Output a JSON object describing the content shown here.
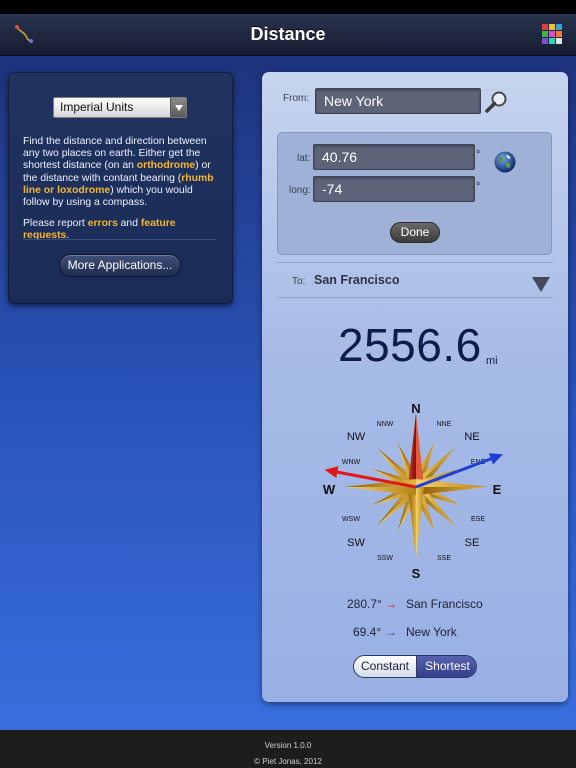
{
  "nav": {
    "title": "Distance",
    "left_icon": "route-icon",
    "right_icon": "color-grid-icon"
  },
  "left_panel": {
    "units_selected": "Imperial Units",
    "description": {
      "t1": "Find the distance and direction between any two places on earth. Either get the shortest distance (on an ",
      "hl1": "orthodrome",
      "t2": ") or the distance with contant bearing (",
      "hl2": "rhumb line or loxodrome",
      "t3": ") which you would follow by using a compass."
    },
    "report": {
      "t1": "Please report ",
      "hl1": "errors",
      "t2": " and ",
      "hl2": "feature requests",
      "t3": "."
    },
    "more_apps_label": "More Applications..."
  },
  "from": {
    "label": "From:",
    "value": "New York"
  },
  "coords": {
    "lat_label": "lat:",
    "lat_value": "40.76",
    "long_label": "long:",
    "long_value": "-74",
    "degree_symbol": "°",
    "done_label": "Done"
  },
  "to": {
    "label": "To:",
    "value": "San Francisco"
  },
  "distance": {
    "value": "2556.6",
    "unit": "mi"
  },
  "compass": {
    "N": "N",
    "NNE": "NNE",
    "NE": "NE",
    "ENE": "ENE",
    "E": "E",
    "ESE": "ESE",
    "SE": "SE",
    "SSE": "SSE",
    "S": "S",
    "SSW": "SSW",
    "SW": "SW",
    "WSW": "WSW",
    "W": "W",
    "WNW": "WNW",
    "NW": "NW",
    "NNW": "NNW",
    "bearing_to_destination": 280.7,
    "bearing_to_origin": 69.4,
    "colors": {
      "destination_arrow": "#e01717",
      "origin_arrow": "#1d3fd8"
    }
  },
  "bearings": [
    {
      "deg": "280.7°",
      "arrow": "→",
      "place": "San Francisco"
    },
    {
      "deg": "69.4°",
      "arrow": "→",
      "place": "New York"
    }
  ],
  "mode": {
    "constant_label": "Constant",
    "shortest_label": "Shortest",
    "selected": "Shortest"
  },
  "footer": {
    "version": "Version 1.0.0",
    "copyright": "© Piet Jonas, 2012"
  }
}
